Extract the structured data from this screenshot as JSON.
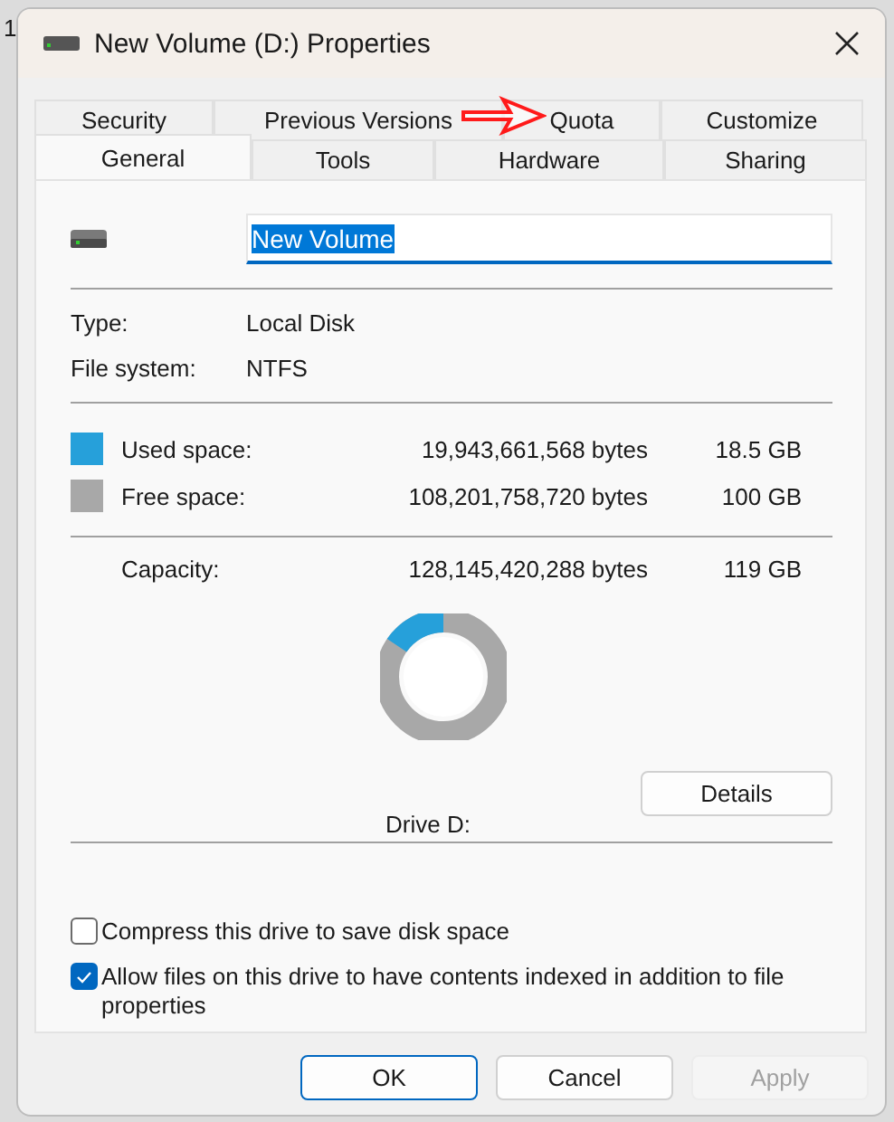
{
  "background_window": {
    "text": "1"
  },
  "window": {
    "title": "New Volume (D:) Properties"
  },
  "tabs": [
    [
      {
        "label": "Security",
        "selected": false
      },
      {
        "label": "Previous Versions",
        "selected": false
      },
      {
        "label": "Quota",
        "selected": false
      },
      {
        "label": "Customize",
        "selected": false
      }
    ],
    [
      {
        "label": "General",
        "selected": true
      },
      {
        "label": "Tools",
        "selected": false
      },
      {
        "label": "Hardware",
        "selected": false
      },
      {
        "label": "Sharing",
        "selected": false
      }
    ]
  ],
  "annotation": {
    "kind": "arrow"
  },
  "name_field": {
    "value": "New Volume",
    "selected": true
  },
  "info": [
    {
      "label": "Type:",
      "value": "Local Disk"
    },
    {
      "label": "File system:",
      "value": "NTFS"
    }
  ],
  "space": [
    {
      "label": "Used space:",
      "bytes": "19,943,661,568 bytes",
      "size": "18.5 GB",
      "color": "#26a0da"
    },
    {
      "label": "Free space:",
      "bytes": "108,201,758,720 bytes",
      "size": "100 GB",
      "color": "#a8a8a8"
    }
  ],
  "capacity": {
    "label": "Capacity:",
    "bytes": "128,145,420,288 bytes",
    "size": "119 GB"
  },
  "drive_label": "Drive D:",
  "details_button": "Details",
  "options": [
    {
      "label": "Compress this drive to save disk space",
      "checked": false
    },
    {
      "label": "Allow files on this drive to have contents indexed in addition to file properties",
      "checked": true
    }
  ],
  "buttons": [
    {
      "label": "OK",
      "kind": "default"
    },
    {
      "label": "Cancel",
      "kind": "normal"
    },
    {
      "label": "Apply",
      "kind": "disabled"
    }
  ]
}
